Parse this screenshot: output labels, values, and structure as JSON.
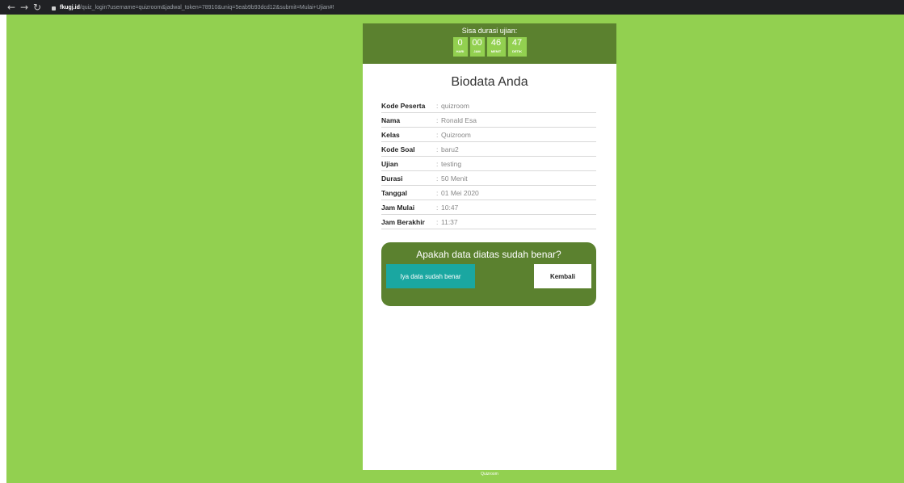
{
  "browser": {
    "url_host": "fkugj.id",
    "url_rest": "/quiz_login?username=quizroom&jadwal_token=78910&uniq=5eab9b93dcd12&submit=Mulai+Ujian#!"
  },
  "timer": {
    "title": "Sisa durasi ujian:",
    "units": [
      {
        "value": "0",
        "label": "HARI"
      },
      {
        "value": "00",
        "label": "JAM"
      },
      {
        "value": "46",
        "label": "MENIT"
      },
      {
        "value": "47",
        "label": "DETIK"
      }
    ]
  },
  "biodata": {
    "title": "Biodata Anda",
    "rows": [
      {
        "label": "Kode Peserta",
        "value": "quizroom"
      },
      {
        "label": "Nama",
        "value": "Ronald Esa"
      },
      {
        "label": "Kelas",
        "value": "Quizroom"
      },
      {
        "label": "Kode Soal",
        "value": "baru2"
      },
      {
        "label": "Ujian",
        "value": "testing"
      },
      {
        "label": "Durasi",
        "value": "50 Menit"
      },
      {
        "label": "Tanggal",
        "value": "01 Mei 2020"
      },
      {
        "label": "Jam Mulai",
        "value": "10:47"
      },
      {
        "label": "Jam Berakhir",
        "value": "11:37"
      }
    ]
  },
  "confirm": {
    "question": "Apakah data diatas sudah benar?",
    "yes_label": "Iya data sudah benar",
    "back_label": "Kembali"
  },
  "footer": {
    "text": "Quizroom"
  },
  "colors": {
    "page_bg": "#92d050",
    "header_green": "#5b812f",
    "yes_button": "#1aa7a1"
  }
}
